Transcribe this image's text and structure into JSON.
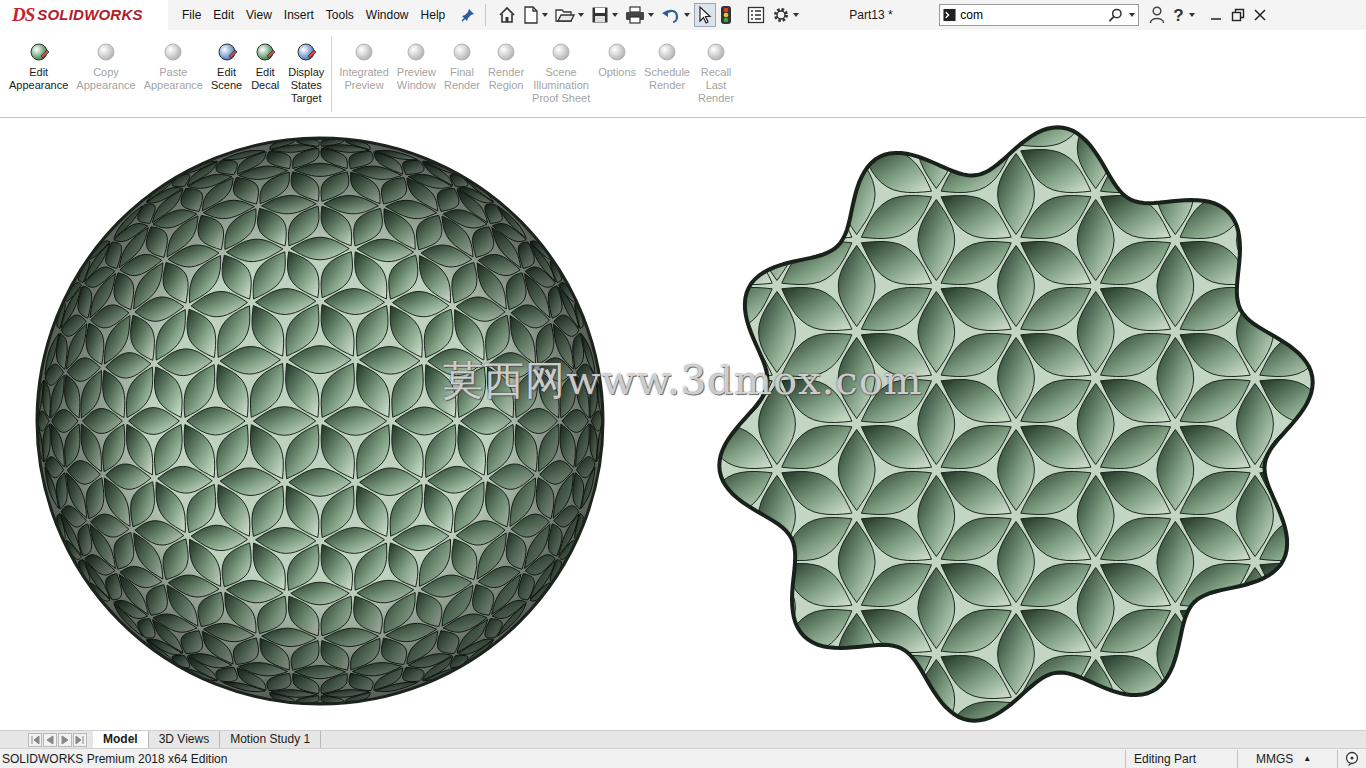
{
  "window": {
    "title": "Part13 *"
  },
  "logo": {
    "mark": "DS",
    "name": "SOLIDWORKS"
  },
  "menu": [
    "File",
    "Edit",
    "View",
    "Insert",
    "Tools",
    "Window",
    "Help"
  ],
  "search": {
    "value": "com"
  },
  "help": "?",
  "ribbon_groups": [
    [
      {
        "lines": [
          "Edit",
          "Appearance"
        ],
        "disabled": false
      },
      {
        "lines": [
          "Copy",
          "Appearance"
        ],
        "disabled": true
      },
      {
        "lines": [
          "Paste",
          "Appearance"
        ],
        "disabled": true
      },
      {
        "lines": [
          "Edit",
          "Scene"
        ],
        "disabled": false
      },
      {
        "lines": [
          "Edit",
          "Decal"
        ],
        "disabled": false
      },
      {
        "lines": [
          "Display",
          "States",
          "Target"
        ],
        "disabled": false
      }
    ],
    [
      {
        "lines": [
          "Integrated",
          "Preview"
        ],
        "disabled": true
      },
      {
        "lines": [
          "Preview",
          "Window"
        ],
        "disabled": true
      },
      {
        "lines": [
          "Final",
          "Render"
        ],
        "disabled": true
      },
      {
        "lines": [
          "Render",
          "Region"
        ],
        "disabled": true
      },
      {
        "lines": [
          "Scene",
          "Illumination",
          "Proof Sheet"
        ],
        "disabled": true
      },
      {
        "lines": [
          "Options"
        ],
        "disabled": true
      },
      {
        "lines": [
          "Schedule",
          "Render"
        ],
        "disabled": true
      },
      {
        "lines": [
          "Recall",
          "Last",
          "Render"
        ],
        "disabled": true
      }
    ]
  ],
  "viewport": {
    "watermark": "莫西网www.3dmox.com"
  },
  "tabs": [
    {
      "label": "Model",
      "selected": true
    },
    {
      "label": "3D Views",
      "selected": false
    },
    {
      "label": "Motion Study 1",
      "selected": false
    }
  ],
  "status_bar": {
    "edition": "SOLIDWORKS Premium 2018 x64 Edition",
    "mode": "Editing Part",
    "units": "MMGS",
    "units_arrow": "▲"
  }
}
